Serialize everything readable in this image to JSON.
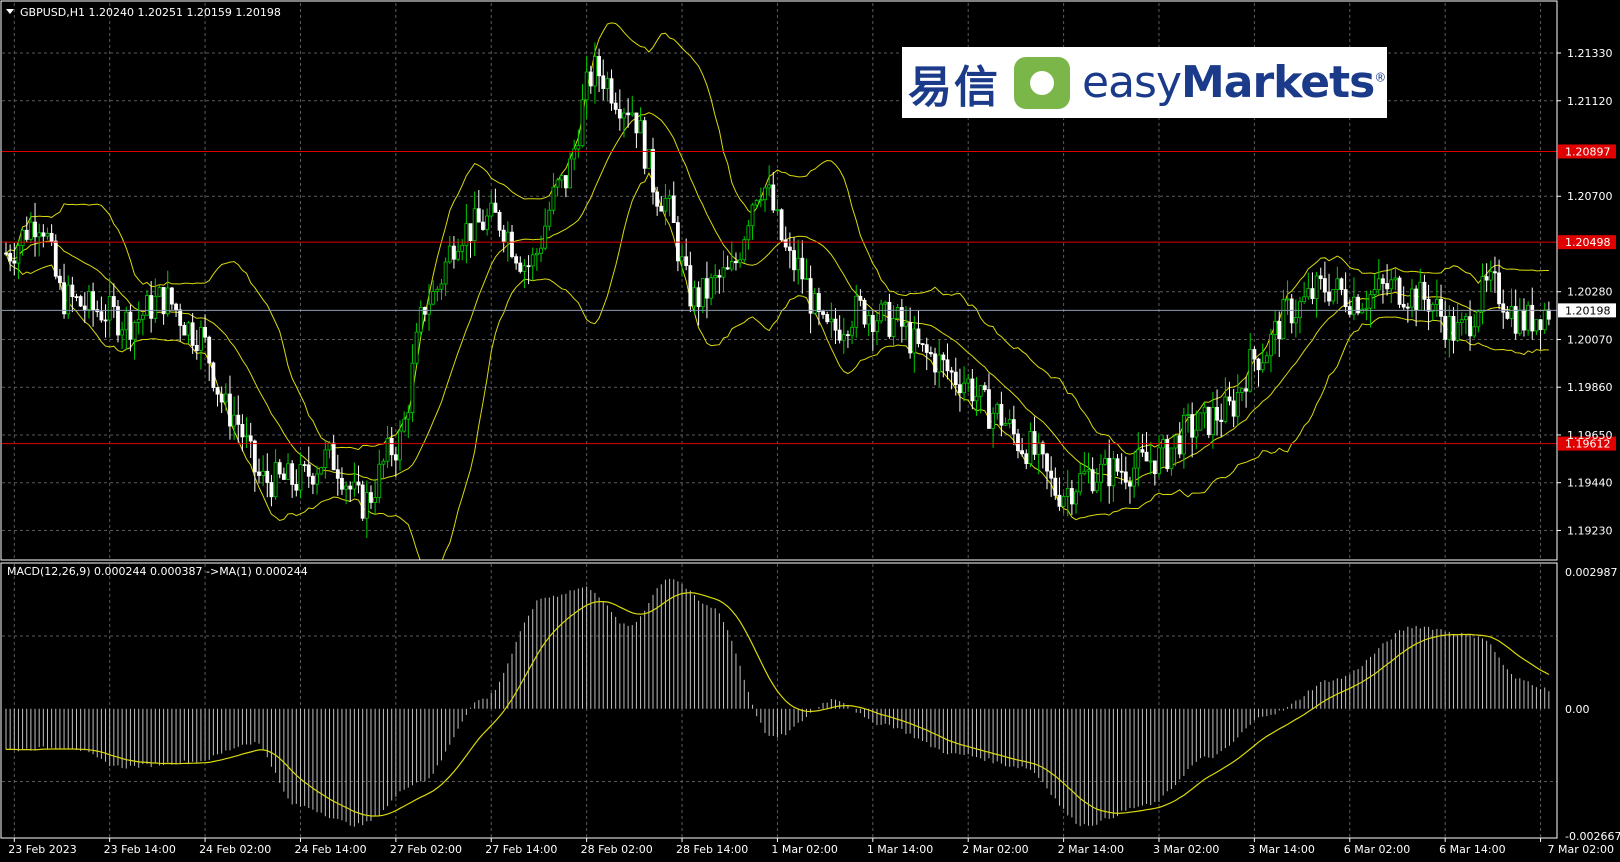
{
  "main_header": "GBPUSD,H1  1.20240 1.20251 1.20159 1.20198",
  "macd_header": "MACD(12,26,9) 0.000244 0.000387  ->MA(1) 0.000244",
  "logo": {
    "chinese": "易信",
    "english_light": "easy",
    "english_bold": "Markets",
    "reg": "®"
  },
  "colors": {
    "background": "#000000",
    "grid": "#5a5a5a",
    "bull": "#00cc00",
    "bear": "#ffffff",
    "band": "#d9d90b",
    "level": "#e00000",
    "histogram": "#c0c0c0",
    "signal": "#d9d90b"
  },
  "chart_data": [
    {
      "type": "candlestick",
      "symbol": "GBPUSD",
      "timeframe": "H1",
      "ylim": [
        1.191,
        1.2155
      ],
      "yticks": [
        "1.21330",
        "1.21120",
        "1.20700",
        "1.20280",
        "1.20070",
        "1.19860",
        "1.19650",
        "1.19440",
        "1.19230"
      ],
      "xticks": [
        "23 Feb 2023",
        "23 Feb 14:00",
        "24 Feb 02:00",
        "24 Feb 14:00",
        "27 Feb 02:00",
        "27 Feb 14:00",
        "28 Feb 02:00",
        "28 Feb 14:00",
        "1 Mar 02:00",
        "1 Mar 14:00",
        "2 Mar 02:00",
        "2 Mar 14:00",
        "3 Mar 02:00",
        "3 Mar 14:00",
        "6 Mar 02:00",
        "6 Mar 14:00",
        "7 Mar 02:00"
      ],
      "indicators": [
        "Bollinger Bands (upper, middle, lower)"
      ],
      "horizontal_levels": [
        {
          "label": "1.20897",
          "value": 1.20897,
          "color": "#e00000"
        },
        {
          "label": "1.20498",
          "value": 1.20498,
          "color": "#e00000"
        },
        {
          "label": "1.19612",
          "value": 1.19612,
          "color": "#e00000"
        }
      ],
      "current_price": {
        "label": "1.20198",
        "value": 1.20198
      },
      "anchors": [
        [
          0,
          1.2045
        ],
        [
          8,
          1.206
        ],
        [
          14,
          1.2025
        ],
        [
          22,
          1.202
        ],
        [
          30,
          1.2015
        ],
        [
          38,
          1.2025
        ],
        [
          46,
          1.201
        ],
        [
          54,
          1.1975
        ],
        [
          62,
          1.1945
        ],
        [
          70,
          1.1945
        ],
        [
          78,
          1.1955
        ],
        [
          86,
          1.1935
        ],
        [
          94,
          1.196
        ],
        [
          102,
          1.2025
        ],
        [
          110,
          1.2055
        ],
        [
          118,
          1.206
        ],
        [
          126,
          1.204
        ],
        [
          134,
          1.2075
        ],
        [
          142,
          1.2125
        ],
        [
          150,
          1.211
        ],
        [
          158,
          1.207
        ],
        [
          166,
          1.2025
        ],
        [
          174,
          1.2035
        ],
        [
          182,
          1.2075
        ],
        [
          190,
          1.204
        ],
        [
          198,
          1.201
        ],
        [
          206,
          1.202
        ],
        [
          214,
          1.2015
        ],
        [
          222,
          1.2
        ],
        [
          230,
          1.199
        ],
        [
          238,
          1.1975
        ],
        [
          246,
          1.196
        ],
        [
          254,
          1.194
        ],
        [
          262,
          1.1948
        ],
        [
          270,
          1.195
        ],
        [
          278,
          1.1955
        ],
        [
          286,
          1.1968
        ],
        [
          294,
          1.1975
        ],
        [
          302,
          1.2
        ],
        [
          310,
          1.202
        ],
        [
          318,
          1.203
        ],
        [
          326,
          1.2025
        ],
        [
          334,
          1.203
        ],
        [
          342,
          1.2025
        ],
        [
          350,
          1.201
        ],
        [
          358,
          1.203
        ],
        [
          366,
          1.2015
        ],
        [
          372,
          1.202
        ]
      ]
    },
    {
      "type": "histogram",
      "name": "MACD(12,26,9)",
      "ylim": [
        -0.002667,
        0.002987
      ],
      "yticks": [
        "0.002987",
        "0.00",
        "-0.002667"
      ],
      "anchors": [
        [
          0,
          -0.00085
        ],
        [
          15,
          -0.0008
        ],
        [
          28,
          -0.0012
        ],
        [
          45,
          -0.0011
        ],
        [
          60,
          -0.0007
        ],
        [
          70,
          -0.002
        ],
        [
          85,
          -0.0024
        ],
        [
          100,
          -0.0015
        ],
        [
          115,
          0.0002
        ],
        [
          130,
          0.0023
        ],
        [
          140,
          0.0025
        ],
        [
          150,
          0.0017
        ],
        [
          160,
          0.0027
        ],
        [
          170,
          0.0021
        ],
        [
          185,
          -0.0006
        ],
        [
          200,
          0.0002
        ],
        [
          210,
          -0.0003
        ],
        [
          230,
          -0.00095
        ],
        [
          245,
          -0.0012
        ],
        [
          260,
          -0.0024
        ],
        [
          275,
          -0.002
        ],
        [
          290,
          -0.001
        ],
        [
          305,
          -0.0001
        ],
        [
          320,
          0.0006
        ],
        [
          340,
          0.0017
        ],
        [
          355,
          0.0015
        ],
        [
          365,
          0.0006
        ],
        [
          372,
          0.0004
        ]
      ],
      "signal_line": "MA(1)"
    }
  ]
}
